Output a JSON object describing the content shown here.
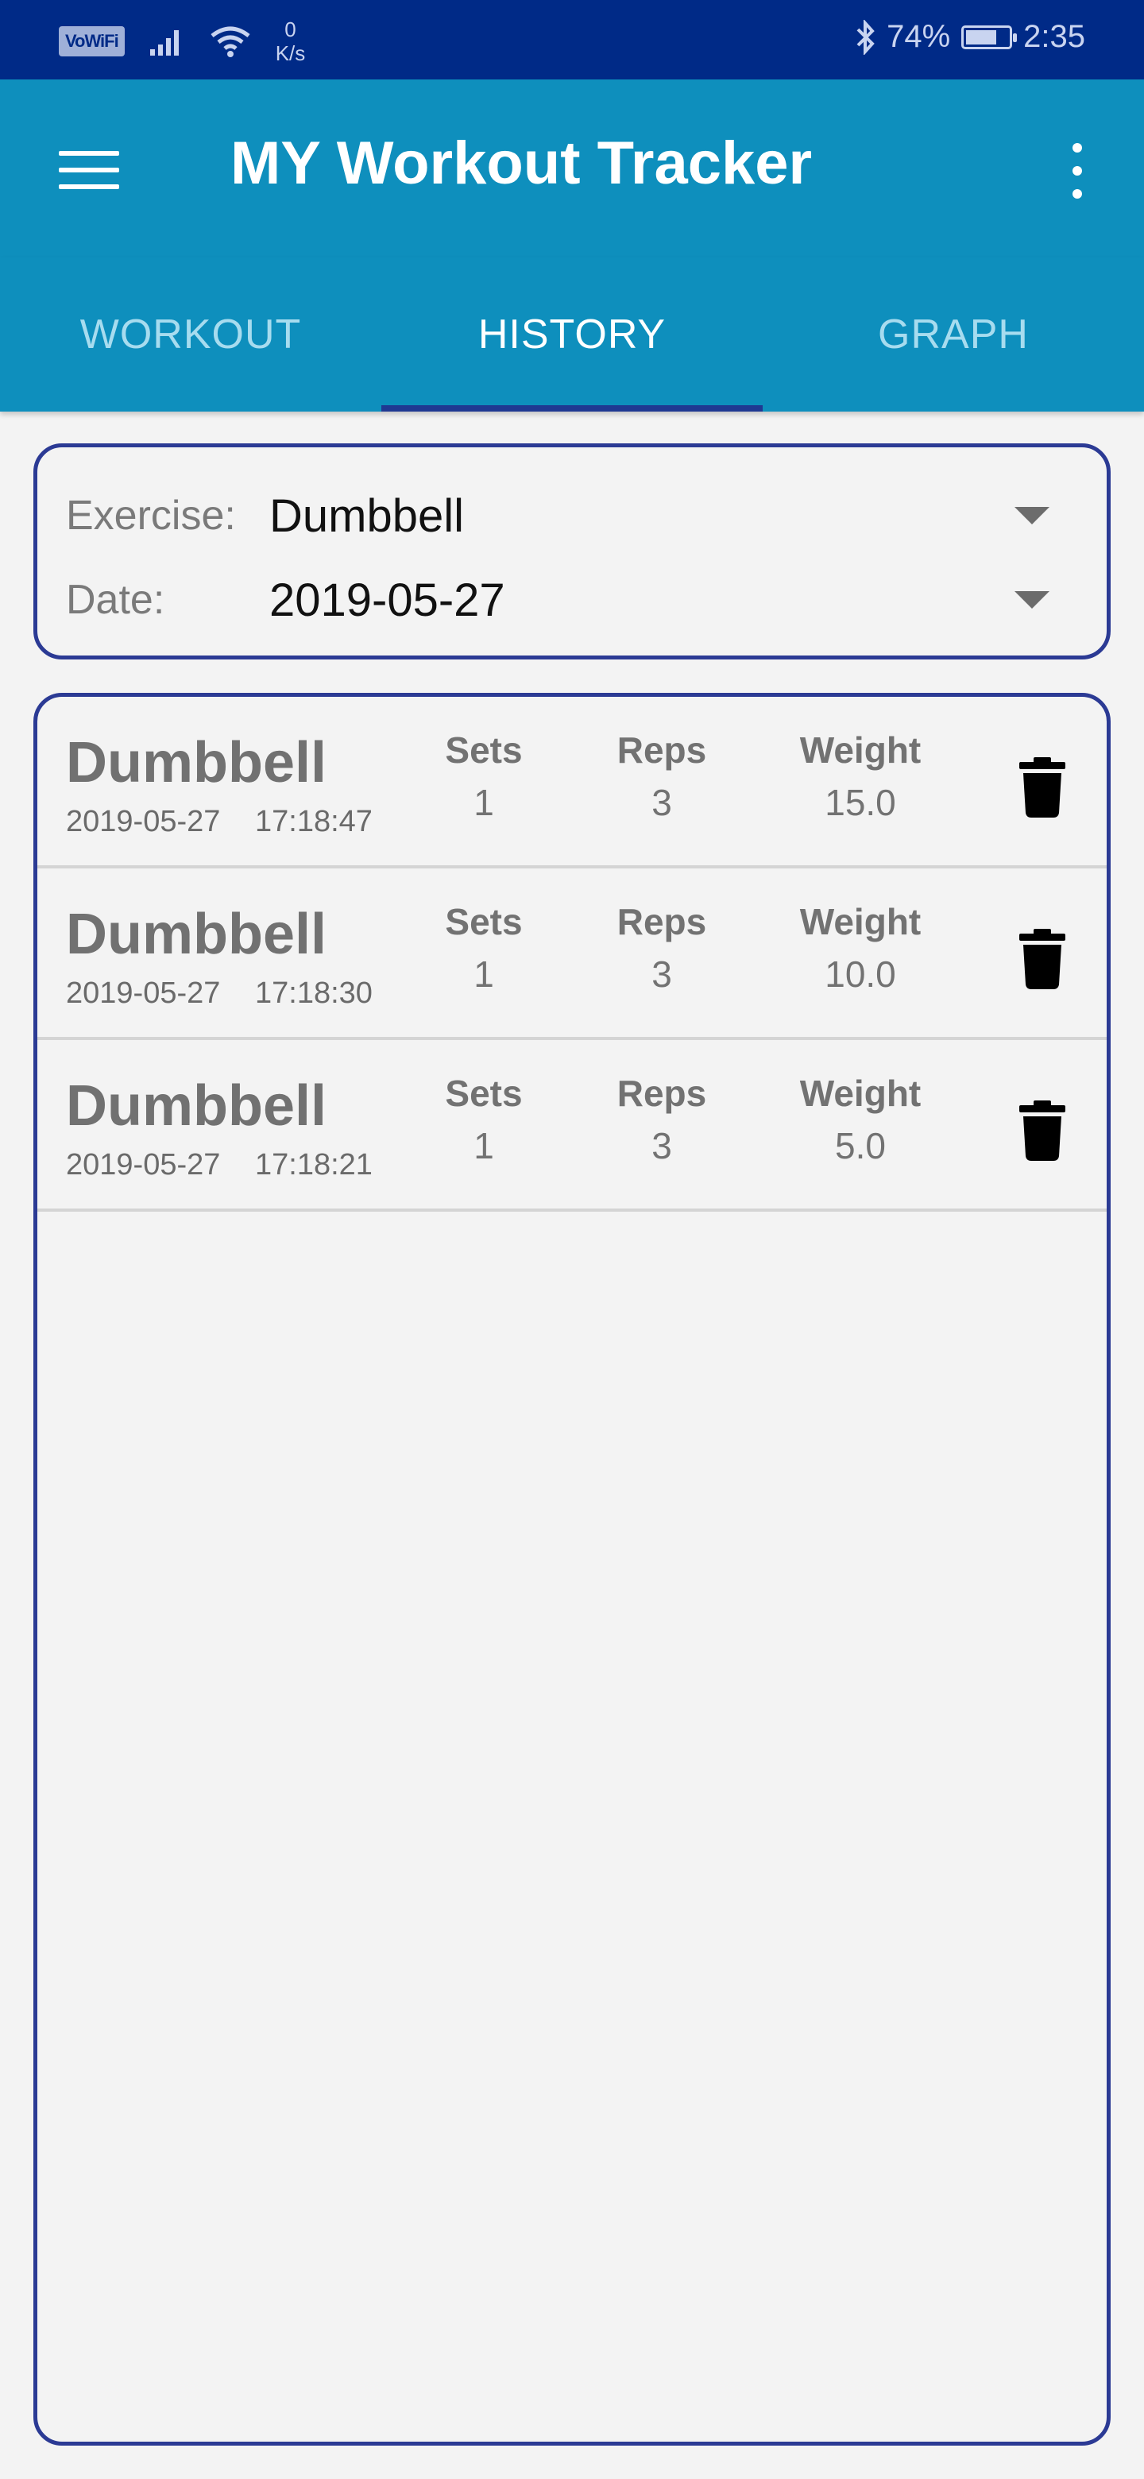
{
  "status_bar": {
    "vowifi": "VoWiFi",
    "speed_value": "0",
    "speed_unit": "K/s",
    "battery": "74%",
    "time": "2:35",
    "battery_level": 0.74
  },
  "app_bar": {
    "title": "MY Workout Tracker"
  },
  "tabs": [
    {
      "label": "WORKOUT",
      "active": false
    },
    {
      "label": "HISTORY",
      "active": true
    },
    {
      "label": "GRAPH",
      "active": false
    }
  ],
  "filters": {
    "exercise_label": "Exercise:",
    "exercise_value": "Dumbbell",
    "date_label": "Date:",
    "date_value": "2019-05-27"
  },
  "history": {
    "sets_label": "Sets",
    "reps_label": "Reps",
    "weight_label": "Weight",
    "rows": [
      {
        "name": "Dumbbell",
        "date": "2019-05-27",
        "time": "17:18:47",
        "sets": "1",
        "reps": "3",
        "weight": "15.0"
      },
      {
        "name": "Dumbbell",
        "date": "2019-05-27",
        "time": "17:18:30",
        "sets": "1",
        "reps": "3",
        "weight": "10.0"
      },
      {
        "name": "Dumbbell",
        "date": "2019-05-27",
        "time": "17:18:21",
        "sets": "1",
        "reps": "3",
        "weight": "5.0"
      }
    ]
  },
  "colors": {
    "status_bar": "#002a87",
    "app_bar": "#0e8fbd",
    "accent_border": "#2b3a94"
  }
}
